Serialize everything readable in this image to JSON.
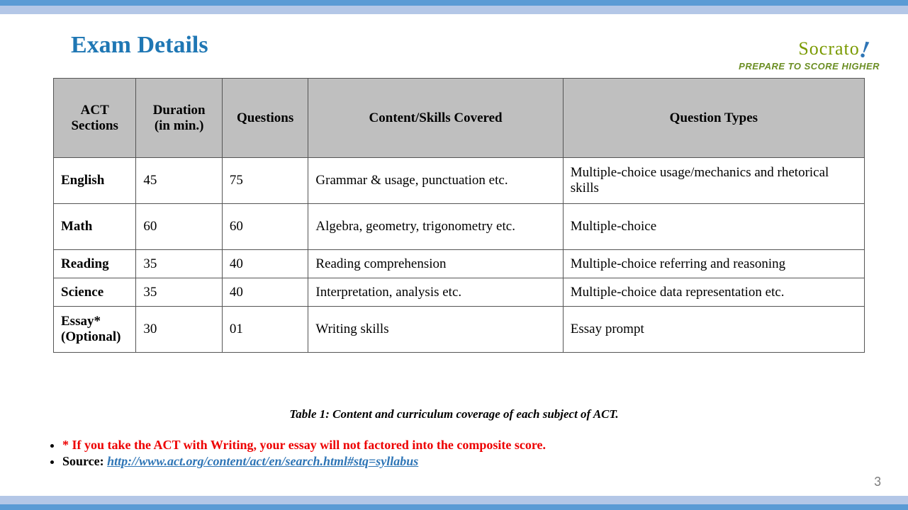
{
  "title": "Exam Details",
  "logo": {
    "brand": "Socrato",
    "tagline": "PREPARE TO SCORE HIGHER"
  },
  "table": {
    "headers": [
      "ACT Sections",
      "Duration (in min.)",
      "Questions",
      "Content/Skills  Covered",
      "Question  Types"
    ],
    "rows": [
      {
        "section": "English",
        "duration": "45",
        "questions": "75",
        "content": "Grammar & usage, punctuation etc.",
        "types": "Multiple-choice  usage/mechanics  and rhetorical  skills"
      },
      {
        "section": "Math",
        "duration": "60",
        "questions": "60",
        "content": "Algebra,  geometry,  trigonometry etc.",
        "types": "Multiple-choice"
      },
      {
        "section": "Reading",
        "duration": "35",
        "questions": "40",
        "content": "Reading comprehension",
        "types": "Multiple-choice  referring  and reasoning"
      },
      {
        "section": "Science",
        "duration": "35",
        "questions": "40",
        "content": "Interpretation,  analysis etc.",
        "types": "Multiple-choice  data representation  etc."
      },
      {
        "section": "Essay* (Optional)",
        "duration": "30",
        "questions": "01",
        "content": "Writing skills",
        "types": "Essay prompt"
      }
    ]
  },
  "caption": "Table 1: Content and curriculum coverage of each subject of ACT.",
  "note": "* If you take the ACT with Writing,  your essay will not factored into the composite score.",
  "source_label": "Source:  ",
  "source_link_text": "http://www.act.org/content/act/en/search.html#stq=syllabus",
  "page_number": "3"
}
